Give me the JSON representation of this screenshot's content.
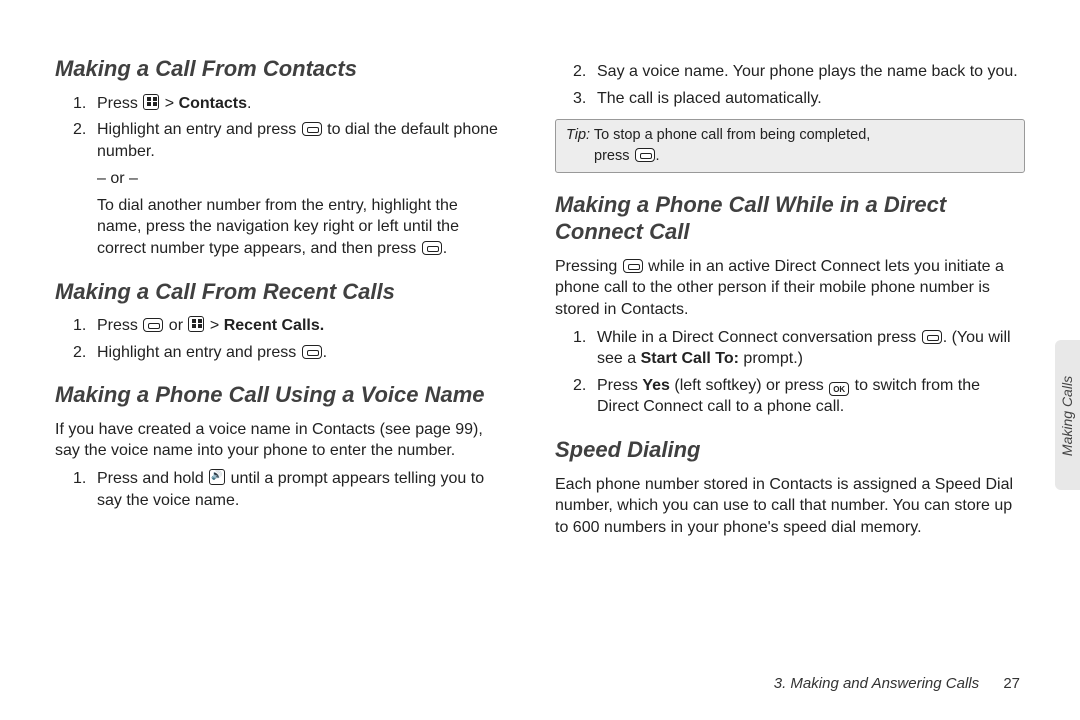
{
  "left": {
    "h1": "Making a Call From Contacts",
    "s1_li1_a": "Press ",
    "s1_li1_b": " > ",
    "s1_li1_c": "Contacts",
    "s1_li1_d": ".",
    "s1_li2_a": "Highlight an entry and press ",
    "s1_li2_b": " to dial the default phone number.",
    "s1_or": "– or –",
    "s1_alt": "To dial another number from the entry, highlight the name, press the navigation key right or left until the correct number type appears, and then press ",
    "s1_alt_end": ".",
    "h2": "Making a Call From Recent Calls",
    "s2_li1_a": "Press ",
    "s2_li1_b": " or ",
    "s2_li1_c": " > ",
    "s2_li1_d": "Recent Calls.",
    "s2_li2_a": "Highlight an entry and press ",
    "s2_li2_b": ".",
    "h3": "Making a Phone Call Using a Voice Name",
    "s3_intro": "If you have created a voice name in Contacts (see page 99), say the voice name into your phone to enter the number.",
    "s3_li1_a": "Press and hold ",
    "s3_li1_b": " until a prompt appears telling you to say the voice name."
  },
  "right": {
    "s3_li2": "Say a voice name. Your phone plays the name back to you.",
    "s3_li3": "The call is placed automatically.",
    "tip_label": "Tip:",
    "tip_a": " To stop a phone call from being completed,",
    "tip_b": "press ",
    "tip_c": ".",
    "h4": "Making a Phone Call While in a Direct Connect Call",
    "s4_intro_a": "Pressing ",
    "s4_intro_b": " while in an active Direct Connect lets you initiate a phone call to the other person if their mobile phone number is stored in Contacts.",
    "s4_li1_a": "While in a Direct Connect conversation press ",
    "s4_li1_b": ". (You will see a ",
    "s4_li1_c": "Start Call To:",
    "s4_li1_d": " prompt.)",
    "s4_li2_a": "Press ",
    "s4_li2_b": "Yes",
    "s4_li2_c": " (left softkey) or press ",
    "s4_li2_d": " to switch from the Direct Connect call to a phone call.",
    "h5": "Speed Dialing",
    "s5_body": "Each phone number stored in Contacts is assigned a Speed Dial number, which you can use to call that number. You can store up to 600 numbers in your phone's speed dial memory."
  },
  "footer": {
    "chapter": "3. Making and Answering Calls",
    "page": "27"
  },
  "sidetab": "Making Calls"
}
